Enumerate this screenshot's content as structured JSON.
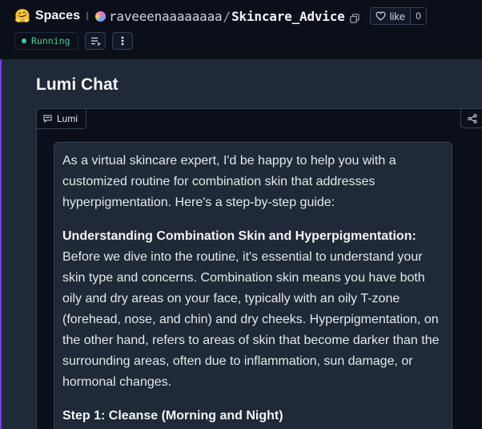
{
  "header": {
    "spaces_label": "Spaces",
    "owner": "raveeenaaaaaaaa",
    "separator": "/",
    "repo": "Skincare_Advice",
    "like_label": "like",
    "like_count": "0",
    "status": "Running",
    "icons": [
      "hugging-face-logo",
      "copy-icon",
      "heart-icon",
      "logs-icon",
      "more-icon"
    ]
  },
  "app": {
    "title": "Lumi Chat"
  },
  "chat": {
    "label": "Lumi",
    "icons": [
      "chat-icon",
      "share-icon"
    ],
    "message": {
      "intro": "As a virtual skincare expert, I'd be happy to help you with a customized routine for combination skin that addresses hyperpigmentation. Here's a step-by-step guide:",
      "section1_heading": "Understanding Combination Skin and Hyperpigmentation:",
      "section1_body": "Before we dive into the routine, it's essential to understand your skin type and concerns. Combination skin means you have both oily and dry areas on your face, typically with an oily T-zone (forehead, nose, and chin) and dry cheeks. Hyperpigmentation, on the other hand, refers to areas of skin that become darker than the surrounding areas, often due to inflammation, sun damage, or hormonal changes.",
      "step1_heading": "Step 1: Cleanse (Morning and Night)"
    }
  },
  "colors": {
    "status_green": "#34d399",
    "background": "#0b0f19",
    "panel": "#1f2937",
    "accent": "#7c3aed"
  }
}
